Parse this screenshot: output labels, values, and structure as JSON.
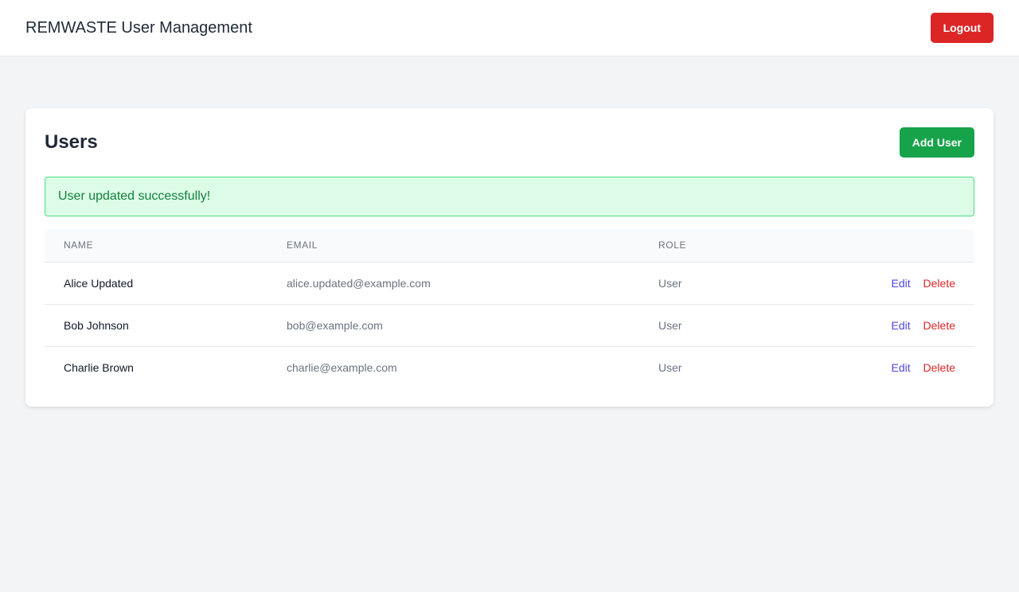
{
  "header": {
    "title": "REMWASTE User Management",
    "logout_label": "Logout"
  },
  "card": {
    "title": "Users",
    "add_user_label": "Add User"
  },
  "alert": {
    "message": "User updated successfully!"
  },
  "table": {
    "columns": [
      "Name",
      "Email",
      "Role",
      ""
    ],
    "rows": [
      {
        "name": "Alice Updated",
        "email": "alice.updated@example.com",
        "role": "User",
        "edit": "Edit",
        "delete": "Delete"
      },
      {
        "name": "Bob Johnson",
        "email": "bob@example.com",
        "role": "User",
        "edit": "Edit",
        "delete": "Delete"
      },
      {
        "name": "Charlie Brown",
        "email": "charlie@example.com",
        "role": "User",
        "edit": "Edit",
        "delete": "Delete"
      }
    ]
  },
  "colors": {
    "logout": "#dc2626",
    "add_user": "#16a34a",
    "alert_bg": "#dcfce7",
    "alert_text": "#15803d",
    "edit_link": "#4f46e5",
    "delete_link": "#dc2626"
  }
}
